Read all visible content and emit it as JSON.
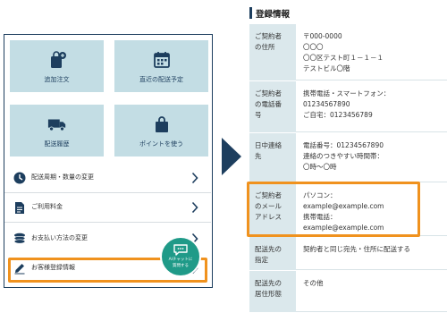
{
  "tiles": [
    {
      "label": "追加注文",
      "icon": "bag-plus-icon"
    },
    {
      "label": "直近の配送予定",
      "icon": "calendar-icon"
    },
    {
      "label": "配送履歴",
      "icon": "truck-icon"
    },
    {
      "label": "ポイントを使う",
      "icon": "shopping-bag-icon"
    }
  ],
  "menu": [
    {
      "label": "配送周期・数量の変更",
      "icon": "clock-icon"
    },
    {
      "label": "ご利用料金",
      "icon": "document-icon"
    },
    {
      "label": "お支払い方法の変更",
      "icon": "coins-icon"
    },
    {
      "label": "お客様登録情報",
      "icon": "pencil-icon"
    }
  ],
  "chat": {
    "line1": "AIチャットに",
    "line2": "質問する"
  },
  "panel": {
    "title": "登録情報",
    "rows": [
      {
        "label": [
          "ご契約者",
          "の住所"
        ],
        "value": [
          "〒000-0000",
          "〇〇〇",
          "〇〇区テスト町１－１－１",
          "テストビル〇階"
        ]
      },
      {
        "label": [
          "ご契約者",
          "の電話番",
          "号"
        ],
        "value": [
          "携帯電話・スマートフォン：",
          "01234567890",
          "ご自宅：0123456789"
        ]
      },
      {
        "label": [
          "日中連絡",
          "先"
        ],
        "value": [
          "電話番号：01234567890",
          "連絡のつきやすい時間帯：",
          "〇時～〇時"
        ]
      },
      {
        "label": [
          "ご契約者",
          "のメール",
          "アドレス"
        ],
        "value": [
          "パソコン：",
          "example@example.com",
          "携帯電話：",
          "example@example.com"
        ]
      },
      {
        "label": [
          "配送先の",
          "指定"
        ],
        "value": [
          "契約者と同じ宛先・住所に配送する"
        ]
      },
      {
        "label": [
          "配送先の",
          "居住形態"
        ],
        "value": [
          "その他"
        ]
      }
    ]
  },
  "colors": {
    "accent": "#f0921e",
    "navy": "#1d3e5e",
    "tile": "#c3dde4",
    "label_bg": "#dbe8ec",
    "chat": "#1f9a88"
  }
}
